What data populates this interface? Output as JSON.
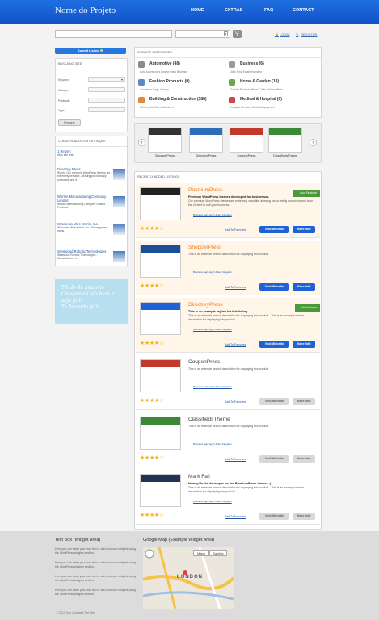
{
  "header": {
    "title": "Nome do Projeto",
    "nav": [
      "HOME",
      "EXTRAS",
      "FAQ",
      "CONTACT"
    ]
  },
  "search": {
    "login": "LOGIN",
    "register": "REGISTER"
  },
  "sidebar": {
    "submit": "Submit Listing",
    "search_title": "BUSCA NO SITE",
    "fields": [
      "Keyword",
      "Category",
      "Postcode",
      "Type"
    ],
    "submit_btn": "Procurar",
    "featured_title": "CLASSIFICADOS EM DESTAQUE",
    "featured": [
      {
        "title": "1 Reizen",
        "desc": "dit is een test."
      },
      {
        "title": "Directory Press",
        "desc": "Shortl - Our premium WordPress themes are extremely versatile, allowing you to easily customize and it."
      },
      {
        "title": "Worton Manufacturing Company Limited",
        "desc": "Worton Manufacturing Company Limited - Products."
      },
      {
        "title": "Wisconsin Wire Works, Inc.",
        "desc": "Wisconsin Wire Works, Inc - All integrated manu."
      },
      {
        "title": "Westwood Robotic Technologies",
        "desc": "Westwood Robotic Technologies - Manufacturers o."
      }
    ],
    "sticky": [
      "Título de anuncio",
      "Compre ao blo bloh e",
      "seja feliz",
      "Te fazendo feliz"
    ]
  },
  "categories": {
    "title": "WEBSITE CATEGORIES",
    "items": [
      {
        "name": "Automotive (48)",
        "sub": "Auto Accessories  Engine Parts  Bearings",
        "color": "#8a8a8a"
      },
      {
        "name": "Business (6)",
        "sub": "Jobs  Real Estate  Investing",
        "color": "#9a9a9a"
      },
      {
        "name": "Fashion Products (0)",
        "sub": "Cosmetics  Bags  Jewelry",
        "color": "#5b89c8"
      },
      {
        "name": "Home & Garden (18)",
        "sub": "Garden Products  Wood Crafts  Kitchen Ware",
        "color": "#6aa84f"
      },
      {
        "name": "Building & Construction (188)",
        "sub": "Flooring  Air Filters  Machines",
        "color": "#e08a3a"
      },
      {
        "name": "Medical & Hospital (0)",
        "sub": "Hospital Furniture  Medical Equipment",
        "color": "#c94a4a"
      }
    ]
  },
  "carousel": {
    "items": [
      "ShopperPress",
      "DirectoryPress",
      "CouponPress",
      "ClassifiedsTheme"
    ]
  },
  "listings_title": "RECENTLY ADDED LISTINGS",
  "listings": [
    {
      "title": "PremiumPress",
      "sub": "Premium WordPress themes developed for businesses.",
      "desc": "Our premium WordPress themes are extremely versatile, allowing you to easily customize and tailor the content to suit your business.",
      "tags": "Business   tag1   tag2   United Kingdom",
      "ribbon": "Cool Featured",
      "visit": "Visit Website",
      "more": "More Info",
      "fav": "Add To Favorites",
      "featured": true,
      "rating": 4
    },
    {
      "title": "ShopperPress",
      "sub": "",
      "desc": "This is an example search description for displaying this product",
      "tags": "Business   tag1   tag2   United Kingdom",
      "ribbon": "",
      "visit": "Visit Website",
      "more": "More Info",
      "fav": "Add To Favorites",
      "featured": true,
      "rating": 4
    },
    {
      "title": "DirectoryPress",
      "sub": "This is an example tagline for this listing.",
      "desc": "This is an example search description for displaying this product - This is an example search description for displaying this product",
      "tags": "Business   tag1   tag2   United Kingdom",
      "ribbon": "Ho bold here",
      "visit": "Visit Website",
      "more": "More Info",
      "fav": "Add To Favorites",
      "featured": true,
      "rating": 4
    },
    {
      "title": "CouponPress",
      "sub": "",
      "desc": "This is an example search description for displaying this product",
      "tags": "Business   tag1   tag2   United Kingdom",
      "ribbon": "",
      "visit": "Visit Website",
      "more": "More Info",
      "fav": "Add To Favorites",
      "featured": false,
      "rating": 4
    },
    {
      "title": "ClassifiedsTheme",
      "sub": "",
      "desc": "This is an example search description for displaying this product",
      "tags": "Business   tag1   tag2   United Kingdom",
      "ribbon": "",
      "visit": "Visit Website",
      "more": "More Info",
      "fav": "Add To Favorites",
      "featured": false,
      "rating": 4
    },
    {
      "title": "Mark Fail",
      "sub": "Howdy! In the developer for the PremiumPress themes :)",
      "desc": "This is an example search description for displaying this product - This is an example search description for displaying this product",
      "tags": "Business   tag1   tag2   United Kingdom",
      "ribbon": "",
      "visit": "Visit Website",
      "more": "More Info",
      "fav": "Add To Favorites",
      "featured": false,
      "rating": 4
    }
  ],
  "footer": {
    "textbox_title": "Text Box (Widget Area)",
    "textbox": [
      "Here you can enter your own text or add your own widgets using the WordPress widgets section.",
      "Here you can enter your own text or add your own widgets using the WordPress widgets section.",
      "Here you can enter your own text or add your own widgets using the WordPress widgets section.",
      "Here you can enter your own text or add your own widgets using the WordPress widgets section."
    ],
    "map_title": "Google Map (Example Widget Area)",
    "map_btn1": "Mapa",
    "map_btn2": "Satélite",
    "map_city": "LONDON",
    "copyright": "© 2013 Your Copyright Text Here"
  }
}
